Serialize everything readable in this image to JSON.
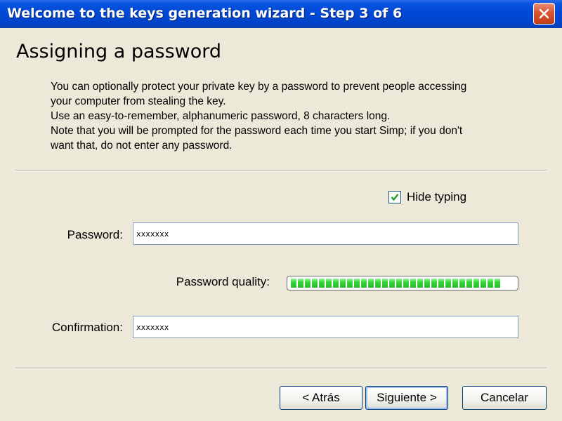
{
  "window": {
    "title": "Welcome to the keys generation wizard - Step 3 of 6",
    "close_icon": "close-icon"
  },
  "page": {
    "heading": "Assigning a password",
    "description_lines": [
      "You can optionally protect your private key by a password to prevent people accessing",
      "your computer from stealing the key.",
      "Use an easy-to-remember, alphanumeric password, 8 characters long.",
      "Note that you will be prompted for the password each time you start Simp; if you don't",
      "want that, do not enter any password."
    ]
  },
  "form": {
    "hide_typing": {
      "label": "Hide typing",
      "checked": true
    },
    "password": {
      "label": "Password:",
      "value": "xxxxxxx"
    },
    "quality": {
      "label": "Password quality:",
      "level_percent": 93,
      "color": "#37d437"
    },
    "confirmation": {
      "label": "Confirmation:",
      "value": "xxxxxxx"
    }
  },
  "buttons": {
    "back": "< Atrás",
    "next": "Siguiente >",
    "cancel": "Cancelar"
  },
  "colors": {
    "titlebar": "#0049d6",
    "window_bg": "#ECE9D8",
    "close_button": "#d8532f"
  }
}
